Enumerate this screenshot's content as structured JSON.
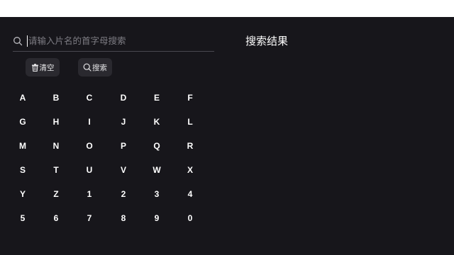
{
  "search": {
    "placeholder": "请输入片名的首字母搜索"
  },
  "buttons": {
    "clear_label": "清空",
    "search_label": "搜索"
  },
  "results": {
    "title": "搜索结果"
  },
  "keyboard": {
    "keys": [
      "A",
      "B",
      "C",
      "D",
      "E",
      "F",
      "G",
      "H",
      "I",
      "J",
      "K",
      "L",
      "M",
      "N",
      "O",
      "P",
      "Q",
      "R",
      "S",
      "T",
      "U",
      "V",
      "W",
      "X",
      "Y",
      "Z",
      "1",
      "2",
      "3",
      "4",
      "5",
      "6",
      "7",
      "8",
      "9",
      "0"
    ]
  },
  "colors": {
    "background": "#17161b",
    "button_bg": "#2a292f",
    "placeholder": "#7d7c83",
    "text": "#ffffff"
  },
  "icons": {
    "search": "search-icon",
    "clear": "trash-icon"
  }
}
